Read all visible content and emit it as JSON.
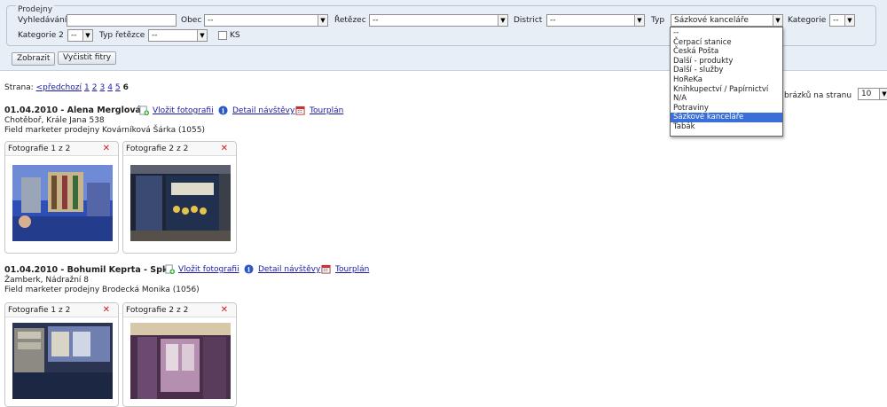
{
  "filter": {
    "legend": "Prodejny",
    "labels": {
      "search": "Vyhledávání",
      "obec": "Obec",
      "retezec": "Řetězec",
      "district": "District",
      "typ": "Typ",
      "kategorie": "Kategorie",
      "kategorie2": "Kategorie 2",
      "typ_retezce": "Typ řetězce",
      "ks": "KS"
    },
    "values": {
      "search": "",
      "obec": "--",
      "retezec": "--",
      "district": "--",
      "typ": "Sázkové kanceláře",
      "kategorie": "--",
      "kategorie2": "--",
      "typ_retezce": "--"
    },
    "buttons": {
      "show": "Zobrazit",
      "clear": "Vyčistit fitry"
    }
  },
  "typ_dropdown": {
    "options": [
      "--",
      "Čerpací stanice",
      "Česká Pošta",
      "Další - produkty",
      "Další - služby",
      "HoReKa",
      "Knihkupectví / Papírnictví",
      "N/A",
      "Potraviny",
      "Sázkové kanceláře",
      "Tabák"
    ],
    "selected_index": 9
  },
  "pager": {
    "prefix": "Strana:",
    "prev": "<předchozí",
    "pages": [
      "1",
      "2",
      "3",
      "4",
      "5"
    ],
    "current": "6",
    "per_page_label": "brázků na stranu",
    "per_page_value": "10"
  },
  "actions": {
    "upload": "Vložit fotografii",
    "detail": "Detail návštěvy",
    "tourplan": "Tourplán"
  },
  "records": [
    {
      "title": "01.04.2010 - Alena Merglová",
      "address": "Chotěboř, Krále Jana 538",
      "marketer": "Field marketer prodejny Kovárníková Šárka (1055)",
      "photos": [
        {
          "label": "Fotografie 1 z 2"
        },
        {
          "label": "Fotografie 2 z 2"
        }
      ]
    },
    {
      "title": "01.04.2010 - Bohumil Keprta - Spk",
      "address": "Žamberk, Nádražní 8",
      "marketer": "Field marketer prodejny Brodecká Monika (1056)",
      "photos": [
        {
          "label": "Fotografie 1 z 2"
        },
        {
          "label": "Fotografie 2 z 2"
        }
      ]
    }
  ],
  "colors": {
    "panel_bg": "#e7eef6",
    "link": "#1a1aa6",
    "delete_x": "#d21b1b",
    "dropdown_highlight": "#3a6fd8"
  }
}
